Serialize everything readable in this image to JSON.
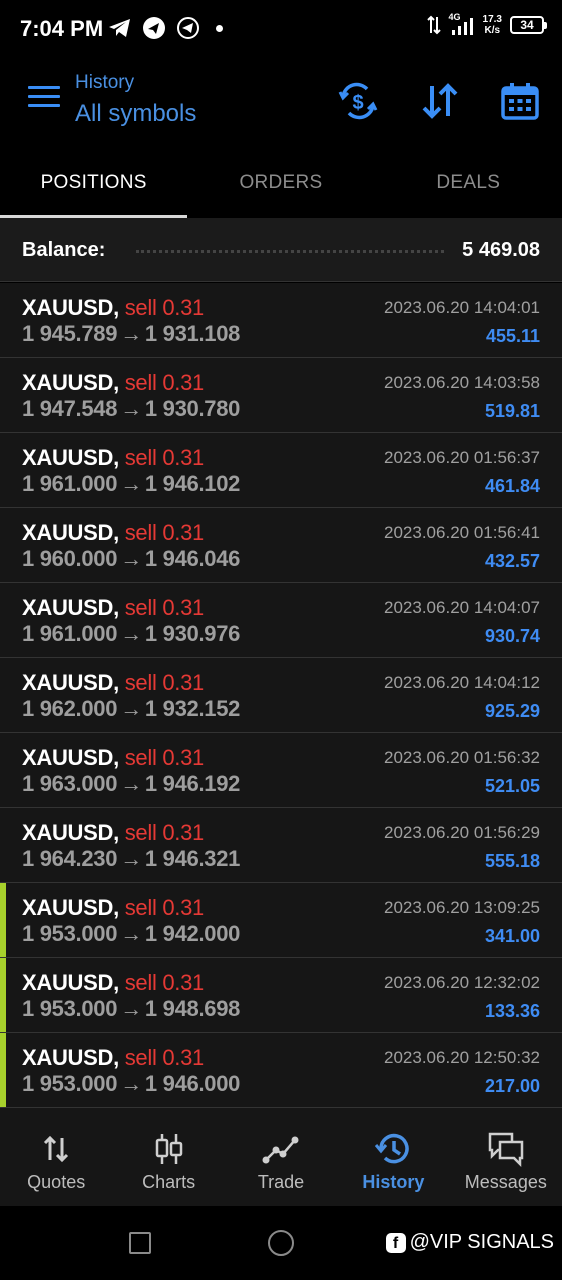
{
  "status_bar": {
    "time": "7:04 PM",
    "network": "4G",
    "speed_value": "17.3",
    "speed_unit": "K/s",
    "battery": "34"
  },
  "header": {
    "subtitle": "History",
    "title": "All symbols",
    "icons": [
      "currency-exchange-icon",
      "sort-icon",
      "calendar-icon"
    ]
  },
  "tabs": [
    {
      "label": "POSITIONS",
      "active": true
    },
    {
      "label": "ORDERS",
      "active": false
    },
    {
      "label": "DEALS",
      "active": false
    }
  ],
  "balance": {
    "label": "Balance:",
    "value": "5 469.08"
  },
  "positions": [
    {
      "symbol": "XAUUSD,",
      "side": "sell 0.31",
      "open": "1 945.789",
      "arrow": "→",
      "close": "1 931.108",
      "time": "2023.06.20 14:04:01",
      "profit": "455.11",
      "marked": false
    },
    {
      "symbol": "XAUUSD,",
      "side": "sell 0.31",
      "open": "1 947.548",
      "arrow": "→",
      "close": "1 930.780",
      "time": "2023.06.20 14:03:58",
      "profit": "519.81",
      "marked": false
    },
    {
      "symbol": "XAUUSD,",
      "side": "sell 0.31",
      "open": "1 961.000",
      "arrow": "→",
      "close": "1 946.102",
      "time": "2023.06.20 01:56:37",
      "profit": "461.84",
      "marked": false
    },
    {
      "symbol": "XAUUSD,",
      "side": "sell 0.31",
      "open": "1 960.000",
      "arrow": "→",
      "close": "1 946.046",
      "time": "2023.06.20 01:56:41",
      "profit": "432.57",
      "marked": false
    },
    {
      "symbol": "XAUUSD,",
      "side": "sell 0.31",
      "open": "1 961.000",
      "arrow": "→",
      "close": "1 930.976",
      "time": "2023.06.20 14:04:07",
      "profit": "930.74",
      "marked": false
    },
    {
      "symbol": "XAUUSD,",
      "side": "sell 0.31",
      "open": "1 962.000",
      "arrow": "→",
      "close": "1 932.152",
      "time": "2023.06.20 14:04:12",
      "profit": "925.29",
      "marked": false
    },
    {
      "symbol": "XAUUSD,",
      "side": "sell 0.31",
      "open": "1 963.000",
      "arrow": "→",
      "close": "1 946.192",
      "time": "2023.06.20 01:56:32",
      "profit": "521.05",
      "marked": false
    },
    {
      "symbol": "XAUUSD,",
      "side": "sell 0.31",
      "open": "1 964.230",
      "arrow": "→",
      "close": "1 946.321",
      "time": "2023.06.20 01:56:29",
      "profit": "555.18",
      "marked": false
    },
    {
      "symbol": "XAUUSD,",
      "side": "sell 0.31",
      "open": "1 953.000",
      "arrow": "→",
      "close": "1 942.000",
      "time": "2023.06.20 13:09:25",
      "profit": "341.00",
      "marked": true
    },
    {
      "symbol": "XAUUSD,",
      "side": "sell 0.31",
      "open": "1 953.000",
      "arrow": "→",
      "close": "1 948.698",
      "time": "2023.06.20 12:32:02",
      "profit": "133.36",
      "marked": true
    },
    {
      "symbol": "XAUUSD,",
      "side": "sell 0.31",
      "open": "1 953.000",
      "arrow": "→",
      "close": "1 946.000",
      "time": "2023.06.20 12:50:32",
      "profit": "217.00",
      "marked": true
    }
  ],
  "bottom_nav": [
    {
      "label": "Quotes",
      "icon": "quotes-icon",
      "active": false
    },
    {
      "label": "Charts",
      "icon": "charts-icon",
      "active": false
    },
    {
      "label": "Trade",
      "icon": "trade-icon",
      "active": false
    },
    {
      "label": "History",
      "icon": "history-icon",
      "active": true
    },
    {
      "label": "Messages",
      "icon": "messages-icon",
      "active": false
    }
  ],
  "watermark": "@VIP SIGNALS",
  "colors": {
    "accent": "#4a90e2",
    "sell": "#e53935",
    "profit": "#3f8cf3",
    "marker": "#a7d12c"
  }
}
